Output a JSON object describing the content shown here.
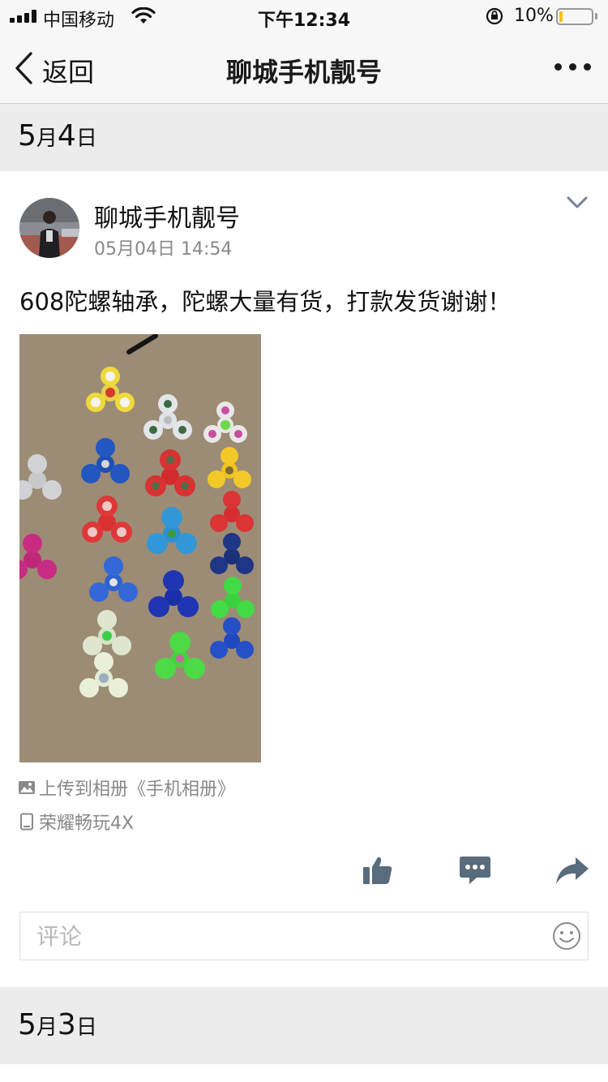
{
  "status_bar": {
    "carrier": "中国移动",
    "time": "下午12:34",
    "battery_text": "10%",
    "battery_level": 0.1,
    "battery_color": "#f5c400"
  },
  "nav": {
    "back_label": "返回",
    "title": "聊城手机靓号",
    "back_icon": "chevron-left-icon",
    "more_icon": "more-dots-icon"
  },
  "dates": {
    "first": {
      "day_num": "5",
      "month_word": "月",
      "date_num": "4",
      "day_word": "日"
    },
    "second": {
      "day_num": "5",
      "month_word": "月",
      "date_num": "3",
      "day_word": "日"
    }
  },
  "post": {
    "author": "聊城手机靓号",
    "timestamp": "05月04日 14:54",
    "text": "608陀螺轴承，陀螺大量有货，打款发货谢谢！",
    "photo_subject": "fidget spinners on cardboard",
    "upload_note": "上传到相册《手机相册》",
    "device": "荣耀畅玩4X",
    "actions": [
      "like-icon",
      "comment-icon",
      "share-icon"
    ],
    "comment_placeholder": "评论",
    "emoji_icon": "emoji-icon"
  }
}
